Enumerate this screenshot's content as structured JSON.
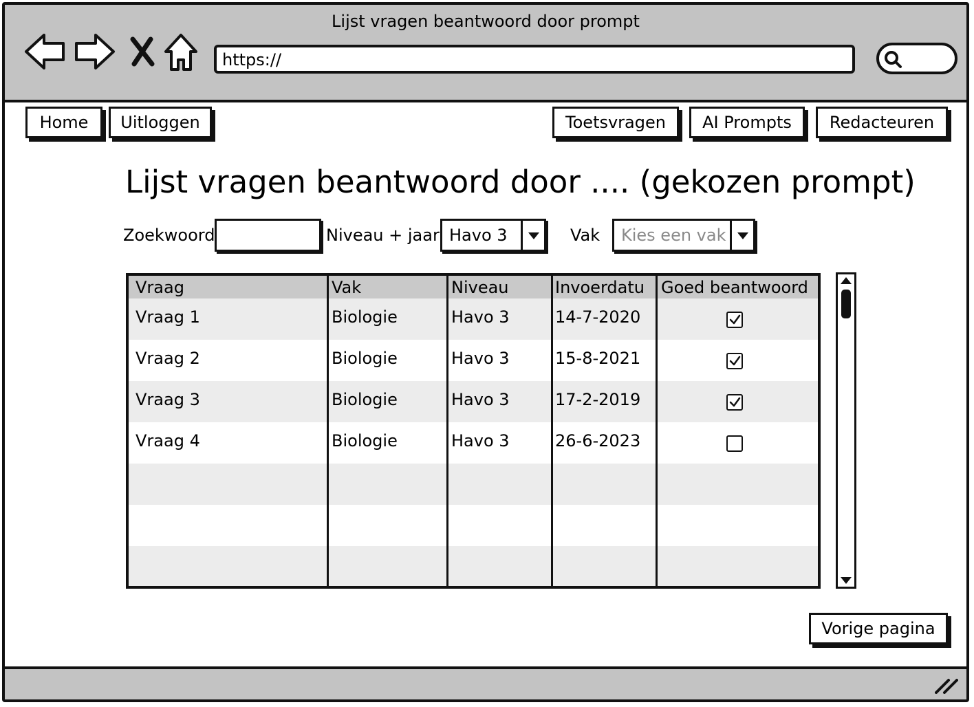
{
  "window": {
    "title": "Lijst vragen beantwoord door prompt"
  },
  "browser": {
    "url": "https://"
  },
  "nav": {
    "home": "Home",
    "logout": "Uitloggen",
    "test_questions": "Toetsvragen",
    "ai_prompts": "AI Prompts",
    "editors": "Redacteuren"
  },
  "page": {
    "title": "Lijst vragen beantwoord door .... (gekozen prompt)"
  },
  "filters": {
    "keyword_label": "Zoekwoord",
    "keyword_value": "",
    "level_label": "Niveau + jaar",
    "level_value": "Havo 3",
    "subject_label": "Vak",
    "subject_placeholder": "Kies een vak"
  },
  "table": {
    "headers": [
      "Vraag",
      "Vak",
      "Niveau",
      "Invoerdatu",
      "Goed beantwoord"
    ],
    "rows": [
      {
        "question": "Vraag 1",
        "subject": "Biologie",
        "level": "Havo 3",
        "date": "14-7-2020",
        "correct": true
      },
      {
        "question": "Vraag 2",
        "subject": "Biologie",
        "level": "Havo 3",
        "date": "15-8-2021",
        "correct": true
      },
      {
        "question": "Vraag 3",
        "subject": "Biologie",
        "level": "Havo 3",
        "date": "17-2-2019",
        "correct": true
      },
      {
        "question": "Vraag 4",
        "subject": "Biologie",
        "level": "Havo 3",
        "date": "26-6-2023",
        "correct": false
      },
      {
        "question": "",
        "subject": "",
        "level": "",
        "date": "",
        "correct": null
      },
      {
        "question": "",
        "subject": "",
        "level": "",
        "date": "",
        "correct": null
      },
      {
        "question": "",
        "subject": "",
        "level": "",
        "date": "",
        "correct": null
      }
    ]
  },
  "footer": {
    "previous_page": "Vorige pagina"
  },
  "icons": [
    "back-arrow-icon",
    "forward-arrow-icon",
    "close-icon",
    "home-icon",
    "search-icon",
    "resize-grip-icon",
    "checkbox-checked-icon",
    "scroll-up-icon",
    "scroll-down-icon"
  ]
}
